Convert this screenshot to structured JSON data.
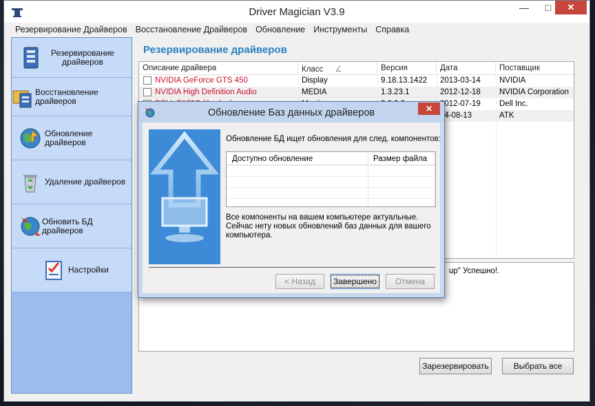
{
  "window": {
    "title": "Driver Magician V3.9",
    "min_symbol": "—",
    "max_symbol": "□",
    "close_symbol": "✕"
  },
  "menu": [
    "Резервирование Драйверов",
    "Восстановление Драйверов",
    "Обновление",
    "Инструменты",
    "Справка"
  ],
  "sidebar": {
    "items": [
      {
        "label": "Резервирование драйверов",
        "icon": "backup-icon"
      },
      {
        "label": "Восстановление драйверов",
        "icon": "restore-icon"
      },
      {
        "label": "Обновление драйверов",
        "icon": "globe-update-icon"
      },
      {
        "label": "Удаление драйверов",
        "icon": "recycle-bin-icon"
      },
      {
        "label": "Обновить БД драйверов",
        "icon": "globe-refresh-icon"
      },
      {
        "label": "Настройки",
        "icon": "settings-checklist-icon"
      }
    ]
  },
  "main": {
    "title": "Резервирование драйверов",
    "columns": [
      "Описание драйвера",
      "Класс",
      "Версия",
      "Дата",
      "Поставщик"
    ],
    "sort_indicator": "∠",
    "rows": [
      {
        "description": "NVIDIA GeForce GTS 450",
        "class": "Display",
        "version": "9.18.13.1422",
        "date": "2013-03-14",
        "vendor": "NVIDIA"
      },
      {
        "description": "NVIDIA High Definition Audio",
        "class": "MEDIA",
        "version": "1.3.23.1",
        "date": "2012-12-18",
        "vendor": "NVIDIA Corporation"
      },
      {
        "description": "DELL E170S (Analog)",
        "class": "Monitor",
        "version": "3.0.0.0",
        "date": "2012-07-19",
        "vendor": "Dell Inc."
      },
      {
        "description": "",
        "class": "",
        "version": "",
        "date": "04-08-13",
        "vendor": "ATK"
      }
    ],
    "log_text": "up\" Успешно!.",
    "backup_button": "Зарезервировать",
    "select_all_button": "Выбрать все"
  },
  "dialog": {
    "title": "Обновление Баз данных драйверов",
    "close_symbol": "✕",
    "description": "Обновление БД ищет обновления для след. компонентов:",
    "columns": [
      "Доступно обновление",
      "Размер файла"
    ],
    "message": "Все компоненты на вашем компьютере актуальные. Сейчас нету новых обновлений баз данных для вашего компьютера.",
    "back_button": "< Назад",
    "finish_button": "Завершено",
    "cancel_button": "Отмена"
  },
  "colors": {
    "accent_title": "#2a7fbf",
    "driver_name_red": "#c8102e",
    "sidebar_bg": "#9bbdee",
    "close_button": "#c7453a"
  }
}
